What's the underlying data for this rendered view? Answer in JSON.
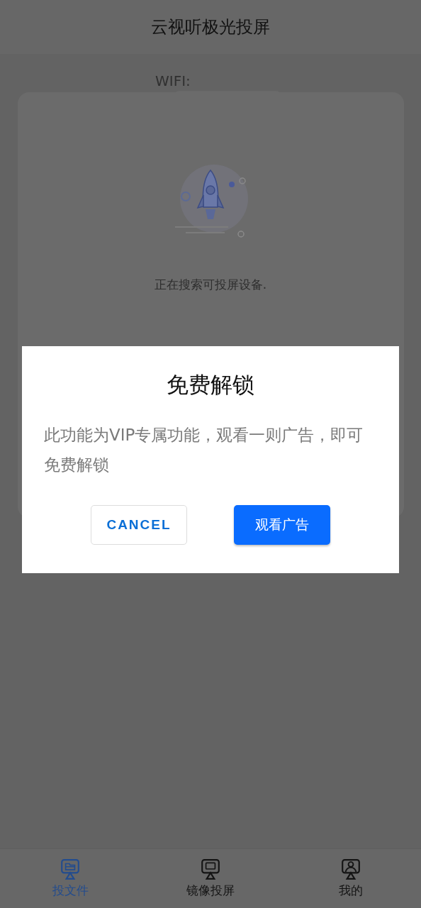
{
  "header": {
    "title": "云视听极光投屏"
  },
  "page": {
    "wifi_label": "WIFI:",
    "status_text": "正在搜索可投屏设备."
  },
  "dialog": {
    "title": "免费解锁",
    "message": "此功能为VIP专属功能，观看一则广告，即可免费解锁",
    "buttons": [
      {
        "label": "CANCEL",
        "kind": "outline"
      },
      {
        "label": "观看广告",
        "kind": "primary"
      }
    ]
  },
  "tabs": [
    {
      "label": "投文件",
      "kind": "file",
      "selected": true
    },
    {
      "label": "镜像投屏",
      "kind": "tv",
      "selected": false
    },
    {
      "label": "我的",
      "kind": "person",
      "selected": false
    }
  ]
}
